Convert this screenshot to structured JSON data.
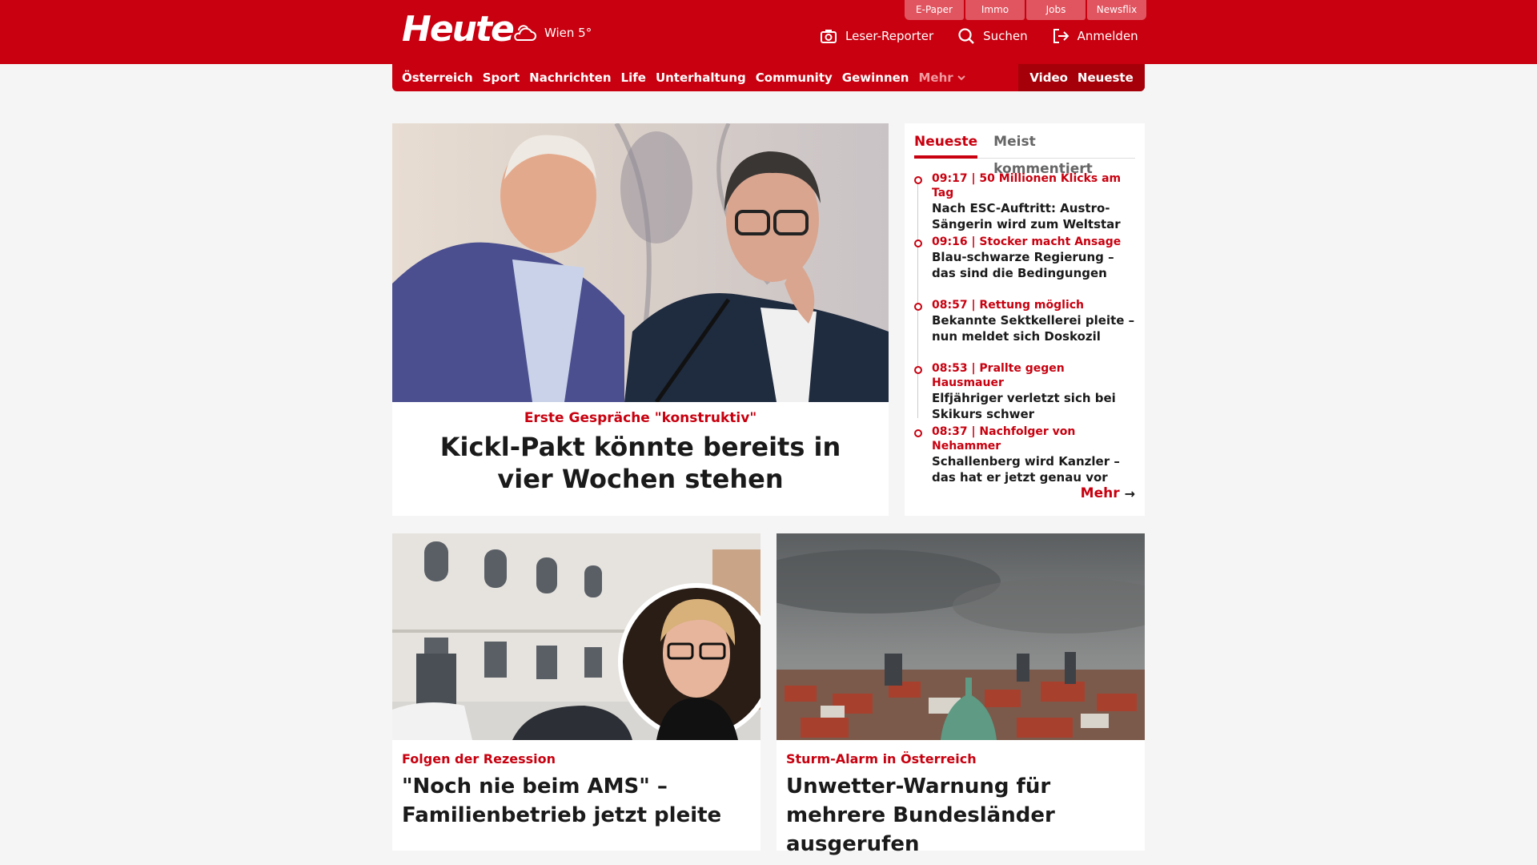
{
  "header": {
    "logo": "Heute",
    "weather": "Wien 5°",
    "top_links": [
      "E-Paper",
      "Immo",
      "Jobs",
      "Newsflix"
    ],
    "actions": [
      {
        "label": "Leser-Reporter",
        "icon": "camera-icon"
      },
      {
        "label": "Suchen",
        "icon": "search-icon"
      },
      {
        "label": "Anmelden",
        "icon": "login-icon"
      }
    ]
  },
  "nav": {
    "items": [
      "Österreich",
      "Sport",
      "Nachrichten",
      "Life",
      "Unterhaltung",
      "Community",
      "Gewinnen"
    ],
    "more": "Mehr",
    "right": [
      "Video",
      "Neueste"
    ]
  },
  "hero": {
    "kicker": "Erste Gespräche \"konstruktiv\"",
    "title": "Kickl-Pakt könnte bereits in vier Wochen stehen"
  },
  "sidebar": {
    "tabs": [
      "Neueste",
      "Meist kommentiert"
    ],
    "items": [
      {
        "kicker": "09:17 | 50 Millionen Klicks am Tag",
        "title": "Nach ESC-Auftritt: Austro-Sängerin wird zum Weltstar"
      },
      {
        "kicker": "09:16 | Stocker macht Ansage",
        "title": "Blau-schwarze Regierung – das sind die Bedingungen"
      },
      {
        "kicker": "08:57 | Rettung möglich",
        "title": "Bekannte Sektkellerei pleite – nun meldet sich Doskozil"
      },
      {
        "kicker": "08:53 | Prallte gegen Hausmauer",
        "title": "Elfjähriger verletzt sich bei Skikurs schwer"
      },
      {
        "kicker": "08:37 | Nachfolger von Nehammer",
        "title": "Schallenberg wird Kanzler – das hat er jetzt genau vor"
      }
    ],
    "more": "Mehr"
  },
  "cards": [
    {
      "kicker": "Folgen der Rezession",
      "title": "\"Noch nie beim AMS\" – Familienbetrieb jetzt pleite"
    },
    {
      "kicker": "Sturm-Alarm in Österreich",
      "title": "Unwetter-Warnung für mehrere Bundesländer ausgerufen"
    }
  ],
  "colors": {
    "brand": "#c8000f",
    "brand_dark": "#a50009"
  }
}
